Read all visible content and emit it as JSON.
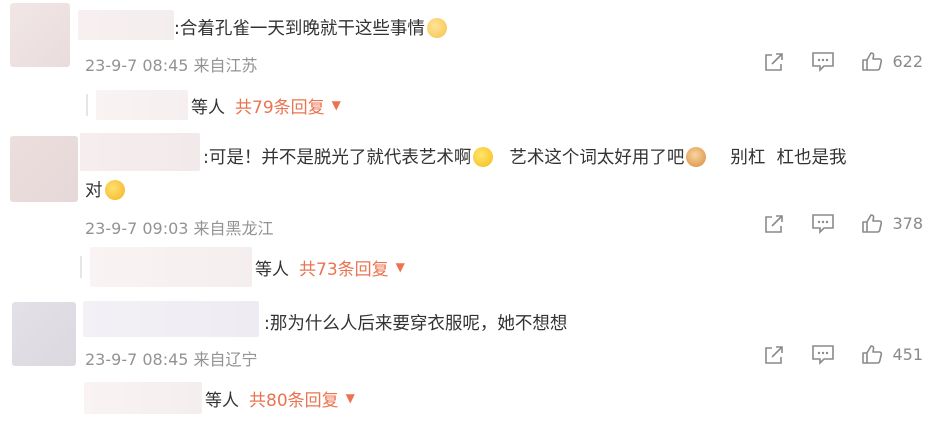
{
  "colors": {
    "accent": "#eb7350",
    "meta": "#939393",
    "text": "#333333"
  },
  "comments": [
    {
      "text": ":合着孔雀一天到晚就干这些事情",
      "emoji1": "cat-smile-emoji",
      "meta": "23-9-7 08:45 来自江苏",
      "likes": "622",
      "reply_label": "等人",
      "reply_count": "共79条回复"
    },
    {
      "text_part1": ":可是！并不是脱光了就代表艺术啊",
      "text_part2": "艺术这个词太好用了吧",
      "text_part3": "别杠  杠也是我",
      "text_line2": "对",
      "meta": "23-9-7 09:03 来自黑龙江",
      "likes": "378",
      "reply_label": "等人",
      "reply_count": "共73条回复"
    },
    {
      "text": ":那为什么人后来要穿衣服呢，她不想想",
      "meta": "23-9-7 08:45 来自辽宁",
      "likes": "451",
      "reply_label": "等人",
      "reply_count": "共80条回复"
    }
  ]
}
